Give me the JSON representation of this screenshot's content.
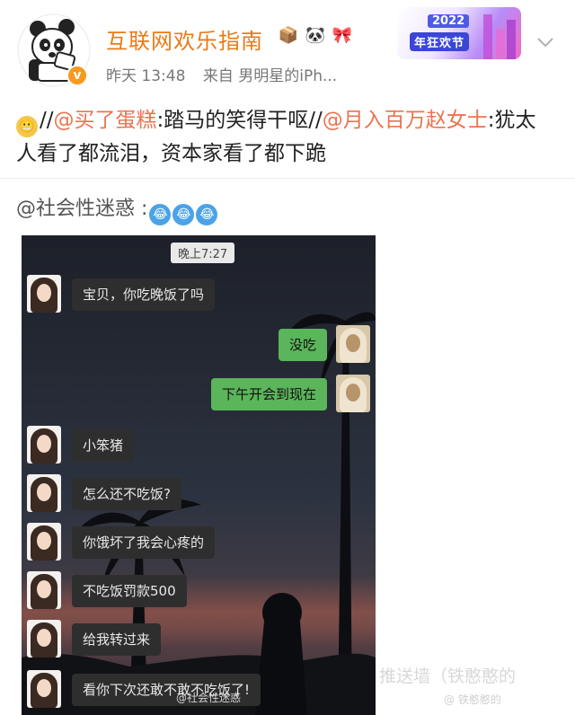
{
  "header": {
    "username": "互联网欢乐指南",
    "badge_emojis": [
      "📦",
      "🐼",
      "🎀"
    ],
    "verified_badge": "v",
    "timestamp": "昨天 13:48",
    "source": "来自 男明星的iPh...",
    "promo": {
      "year": "2022",
      "title": "年狂欢节"
    }
  },
  "post": {
    "line1_emoji": "😬",
    "segments": [
      {
        "text": "//",
        "type": "plain"
      },
      {
        "text": "@买了蛋糕",
        "type": "mention"
      },
      {
        "text": ":踏马的笑得干呕//",
        "type": "plain"
      },
      {
        "text": "@月入百万赵女士",
        "type": "mention"
      },
      {
        "text": ":犹太人看了都流泪，资本家看了都下跪",
        "type": "plain"
      }
    ],
    "sub_mention": "@社会性迷惑 :",
    "sub_emojis": [
      "😂",
      "😂",
      "😂"
    ]
  },
  "chat": {
    "time": "晚上7:27",
    "messages": [
      {
        "side": "in",
        "text": "宝贝，你吃晚饭了吗"
      },
      {
        "side": "out",
        "text": "没吃"
      },
      {
        "side": "out",
        "text": "下午开会到现在"
      },
      {
        "side": "in",
        "text": "小笨猪"
      },
      {
        "side": "in",
        "text": "怎么还不吃饭?"
      },
      {
        "side": "in",
        "text": "你饿坏了我会心疼的"
      },
      {
        "side": "in",
        "text": "不吃饭罚款500"
      },
      {
        "side": "in",
        "text": "给我转过来"
      },
      {
        "side": "in",
        "text": "看你下次还敢不敢不吃饭了!"
      }
    ],
    "image_watermark": "@社会性迷惑"
  },
  "overlay_watermark": {
    "line1": "推送墙（铁憨憨的",
    "line2": "@ 铁憨憨的"
  }
}
